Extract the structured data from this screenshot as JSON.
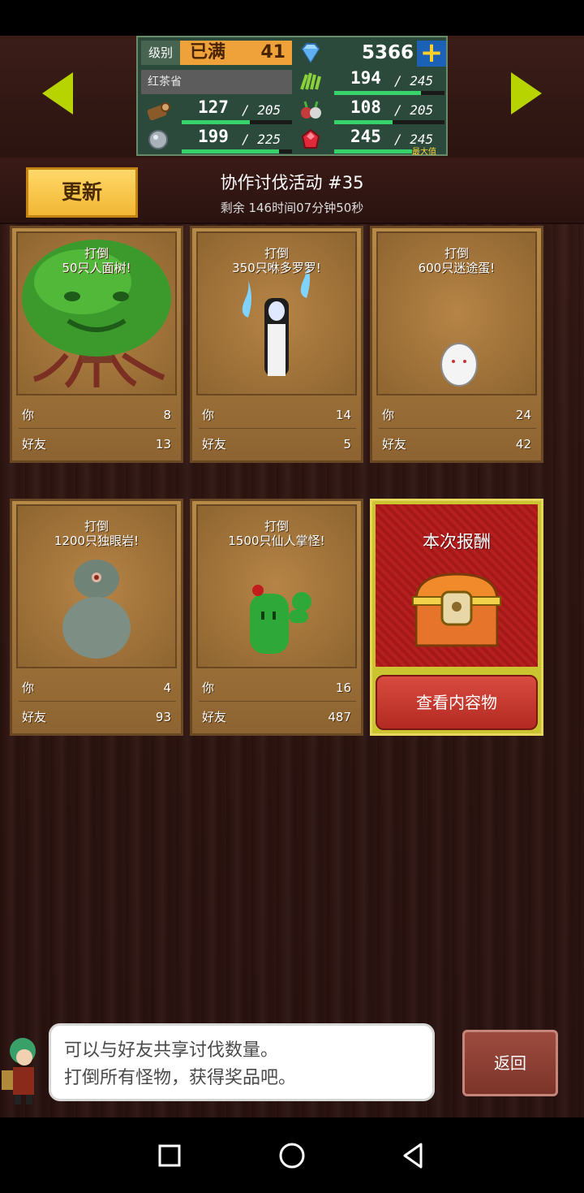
{
  "hud": {
    "level_label": "级别",
    "level_max": "已满",
    "level_value": "41",
    "region": "红茶省",
    "gems": "5366",
    "plus": "+",
    "stats": [
      {
        "name": "wood",
        "icon": "wood-log-icon",
        "current": "127",
        "max": "205",
        "fill": 0.62
      },
      {
        "name": "ore",
        "icon": "ore-stone-icon",
        "current": "199",
        "max": "225",
        "fill": 0.88
      },
      {
        "name": "grass",
        "icon": "herb-icon",
        "current": "194",
        "max": "245",
        "fill": 0.79
      },
      {
        "name": "food",
        "icon": "vegetable-icon",
        "current": "108",
        "max": "205",
        "fill": 0.53
      },
      {
        "name": "ruby",
        "icon": "ruby-gem-icon",
        "current": "245",
        "max": "245",
        "fill": 1.0
      }
    ],
    "max_tag": "最大值"
  },
  "event": {
    "update_label": "更新",
    "title": "协作讨伐活动 #35",
    "remaining": "剩余 146时间07分钟50秒"
  },
  "cards": [
    {
      "line1": "打倒",
      "line2": "50只人面树!",
      "you_label": "你",
      "you": "8",
      "friend_label": "好友",
      "friends": "13"
    },
    {
      "line1": "打倒",
      "line2": "350只咻多罗罗!",
      "you_label": "你",
      "you": "14",
      "friend_label": "好友",
      "friends": "5"
    },
    {
      "line1": "打倒",
      "line2": "600只迷途蛋!",
      "you_label": "你",
      "you": "24",
      "friend_label": "好友",
      "friends": "42"
    },
    {
      "line1": "打倒",
      "line2": "1200只独眼岩!",
      "you_label": "你",
      "you": "4",
      "friend_label": "好友",
      "friends": "93"
    },
    {
      "line1": "打倒",
      "line2": "1500只仙人掌怪!",
      "you_label": "你",
      "you": "16",
      "friend_label": "好友",
      "friends": "487"
    }
  ],
  "reward": {
    "title": "本次报酬",
    "button": "查看内容物"
  },
  "dialog": {
    "line1": "可以与好友共享讨伐数量。",
    "line2": "打倒所有怪物，获得奖品吧。"
  },
  "back_label": "返回",
  "colors": {
    "accent_green": "#b7d400",
    "bar_fill": "#37d36a",
    "update_btn": "#f2b734",
    "reward_red": "#b51f1f"
  }
}
